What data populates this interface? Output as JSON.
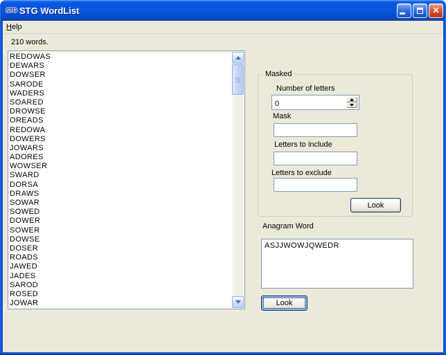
{
  "window": {
    "title": "STG WordList",
    "icon_text": "STG",
    "controls": {
      "minimize": "minimize",
      "maximize": "maximize",
      "close": "close"
    }
  },
  "menu": {
    "items": [
      {
        "label": "Help"
      }
    ]
  },
  "word_count_label": "210 words.",
  "word_list": [
    "REDOWAS",
    "DEWARS",
    "DOWSER",
    "SARODE",
    "WADERS",
    "SOARED",
    "DROWSE",
    "OREADS",
    "REDOWA",
    "DOWERS",
    "JOWARS",
    "ADORES",
    "WOWSER",
    "SWARD",
    "DORSA",
    "DRAWS",
    "SOWAR",
    "SOWED",
    "DOWER",
    "SOWER",
    "DOWSE",
    "DOSER",
    "ROADS",
    "JAWED",
    "JADES",
    "SAROD",
    "ROSED",
    "JOWAR"
  ],
  "masked_group": {
    "title": "Masked",
    "number_of_letters_label": "Number of letters",
    "number_of_letters_value": "0",
    "mask_label": "Mask",
    "mask_value": "",
    "letters_include_label": "Letters to include",
    "letters_include_value": "",
    "letters_exclude_label": "Letters to exclude",
    "letters_exclude_value": "",
    "look_button_label": "Look"
  },
  "anagram": {
    "label": "Anagram Word",
    "value": "ASJJWOWJQWEDR",
    "look_button_label": "Look"
  },
  "colors": {
    "titlebar_blue": "#0855DC",
    "dialog_bg": "#ECE9D8",
    "edit_border": "#7F9DB9",
    "button_border": "#003C74",
    "close_button_red": "#CC4222",
    "scrollbar_blue": "#C4D6F8"
  }
}
